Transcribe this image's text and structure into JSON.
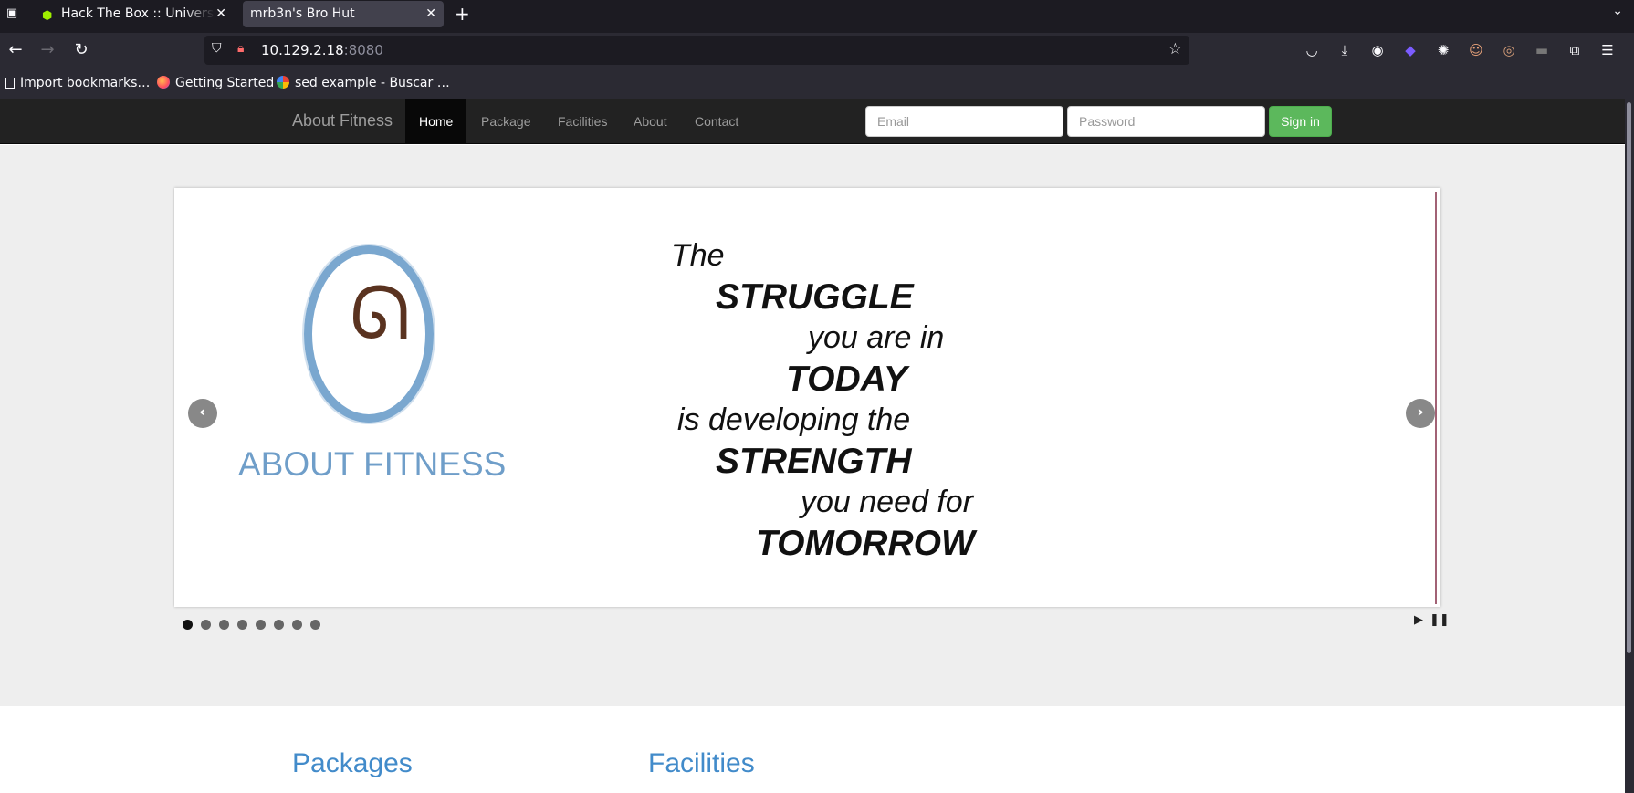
{
  "browser": {
    "tabs": [
      {
        "title": "Hack The Box :: Universities",
        "active": false
      },
      {
        "title": "mrb3n's Bro Hut",
        "active": true
      }
    ],
    "url_host": "10.129.2.18",
    "url_port": ":8080",
    "bookmarks": [
      {
        "label": "Import bookmarks…",
        "icon": "import-icon"
      },
      {
        "label": "Getting Started",
        "icon": "firefox-icon"
      },
      {
        "label": "sed example - Buscar …",
        "icon": "google-icon"
      }
    ]
  },
  "site": {
    "brand": "About Fitness",
    "menu": [
      "Home",
      "Package",
      "Facilities",
      "About",
      "Contact"
    ],
    "email_placeholder": "Email",
    "password_placeholder": "Password",
    "signin_label": "Sign in"
  },
  "carousel": {
    "logo_text": "ABOUT FITNESS",
    "quote_lines": [
      {
        "text": "The",
        "style": "plain"
      },
      {
        "text": "STRUGGLE",
        "style": "bold"
      },
      {
        "text": "you are in",
        "style": "plain"
      },
      {
        "text": "TODAY",
        "style": "bold"
      },
      {
        "text": "is developing the",
        "style": "plain"
      },
      {
        "text": "STRENGTH",
        "style": "bold"
      },
      {
        "text": "you need for",
        "style": "plain"
      },
      {
        "text": "TOMORROW",
        "style": "bold"
      }
    ],
    "slide_count": 8,
    "active_slide": 1
  },
  "sections": {
    "packages_title": "Packages",
    "facilities_title": "Facilities"
  }
}
